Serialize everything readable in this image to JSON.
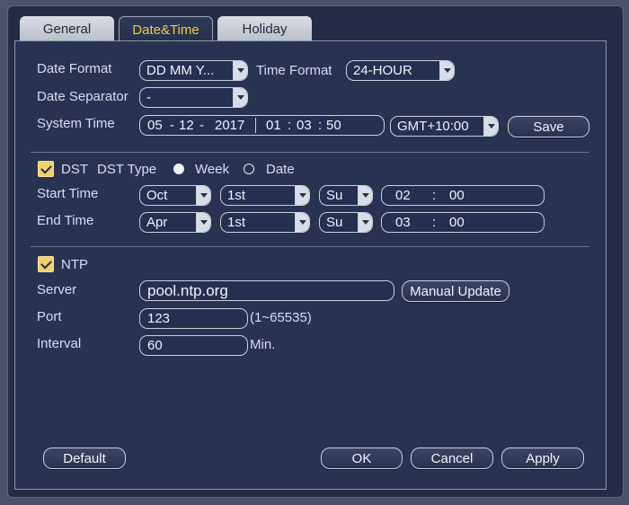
{
  "tabs": [
    {
      "label": "General"
    },
    {
      "label": "Date&Time"
    },
    {
      "label": "Holiday"
    }
  ],
  "datetime": {
    "date_format_label": "Date Format",
    "date_format_value": "DD MM Y...",
    "time_format_label": "Time Format",
    "time_format_value": "24-HOUR",
    "date_separator_label": "Date Separator",
    "date_separator_value": "-",
    "system_time_label": "System Time",
    "system_time": {
      "day": "05",
      "sep1": "-",
      "month": "12",
      "sep2": "-",
      "year": "2017",
      "hour": "01",
      "c1": ":",
      "minute": "03",
      "c2": ":",
      "second": "50"
    },
    "timezone_value": "GMT+10:00",
    "save_label": "Save"
  },
  "dst": {
    "label": "DST",
    "type_label": "DST Type",
    "option_week": "Week",
    "option_date": "Date",
    "start_label": "Start Time",
    "end_label": "End Time",
    "start": {
      "month": "Oct",
      "week": "1st",
      "day": "Su",
      "hour": "02",
      "colon": ":",
      "minute": "00"
    },
    "end": {
      "month": "Apr",
      "week": "1st",
      "day": "Su",
      "hour": "03",
      "colon": ":",
      "minute": "00"
    }
  },
  "ntp": {
    "label": "NTP",
    "server_label": "Server",
    "server_value": "pool.ntp.org",
    "manual_update_label": "Manual Update",
    "port_label": "Port",
    "port_value": "123",
    "port_range": "(1~65535)",
    "interval_label": "Interval",
    "interval_value": "60",
    "interval_unit": "Min."
  },
  "footer": {
    "default_label": "Default",
    "ok_label": "OK",
    "cancel_label": "Cancel",
    "apply_label": "Apply"
  }
}
